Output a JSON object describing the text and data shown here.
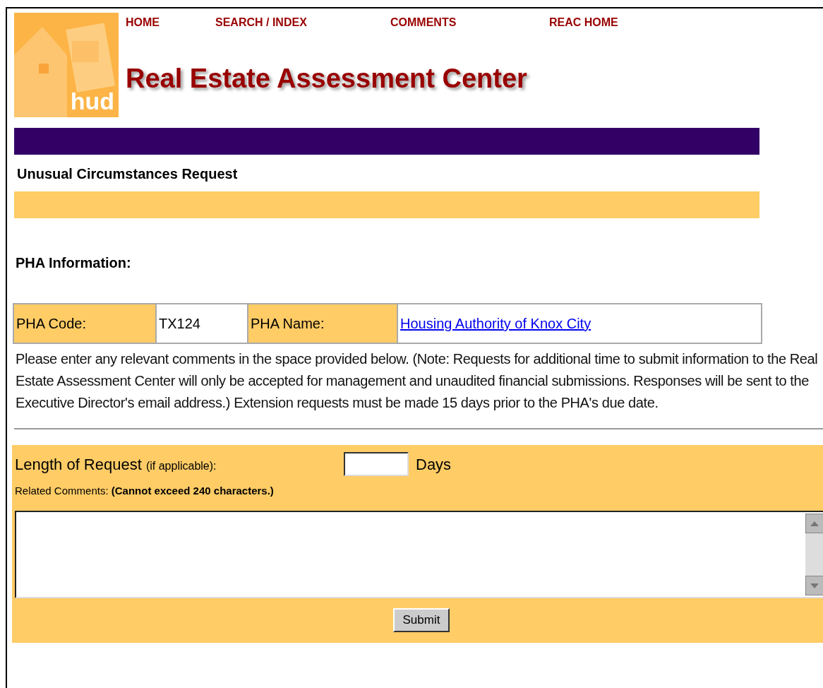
{
  "nav": [
    {
      "label": "HOME"
    },
    {
      "label": "SEARCH / INDEX"
    },
    {
      "label": "COMMENTS"
    },
    {
      "label": "REAC HOME"
    }
  ],
  "logo": {
    "text": "hud"
  },
  "site_title": "Real Estate Assessment Center",
  "page_heading": "Unusual Circumstances Request",
  "section_heading": "PHA Information:",
  "pha_table": {
    "code_label": "PHA Code:",
    "code_value": "TX124",
    "name_label": "PHA Name:",
    "name_value": "Housing Authority of Knox City"
  },
  "instructions": "Please enter any relevant comments in the space provided below. (Note: Requests for additional time to submit information to the Real Estate Assessment Center will only be accepted for management and unaudited financial submissions. Responses will be sent to the Executive Director's email address.) Extension requests must be made 15 days prior to the PHA's due date.",
  "form": {
    "length_label": "Length of Request",
    "length_hint": "(if applicable):",
    "days_label": "Days",
    "comments_label": "Related Comments: **(Cannot exceed 240 characters.)**",
    "submit": "Submit"
  }
}
